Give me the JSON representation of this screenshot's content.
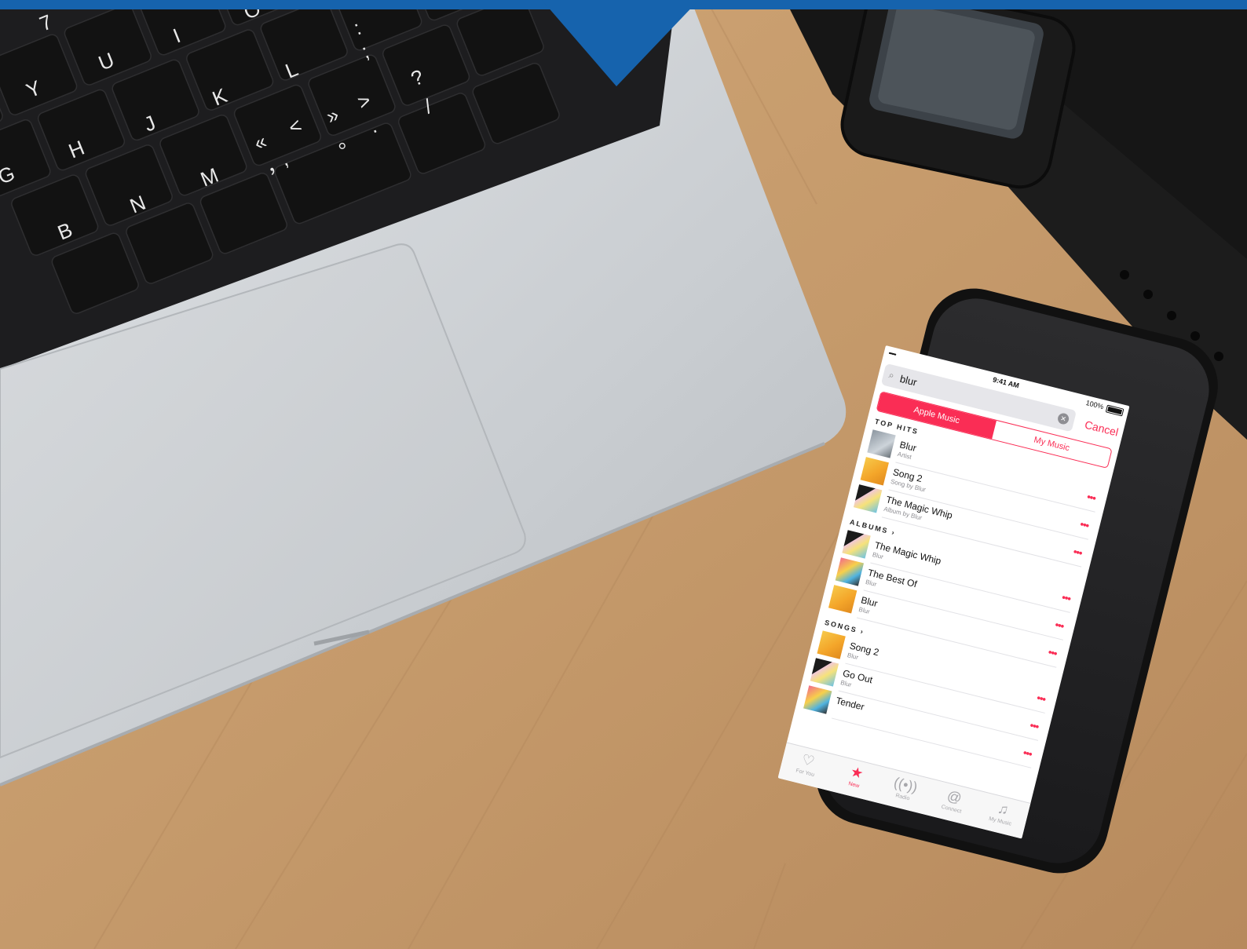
{
  "scene": {
    "colors": {
      "banner_blue": "#1663ad",
      "desk_wood": "#c59a6b",
      "laptop_silver": "#cfd3d7",
      "key_black": "#151515",
      "phone_case": "#121212",
      "watch_black": "#161616",
      "accent": "#fa2d55"
    },
    "keyboard": {
      "keys": [
        "7",
        "O",
        "I",
        "U",
        "Y",
        "L",
        "K",
        "J",
        "H",
        "G",
        "M",
        "N",
        "B",
        "?",
        "/",
        ":",
        ";",
        ">",
        ".",
        "»",
        "。",
        "<",
        ",",
        "«",
        "，"
      ]
    }
  },
  "phone": {
    "status": {
      "signal": "•••••",
      "time": "9:41 AM",
      "battery": "100%"
    },
    "search": {
      "query": "blur",
      "cancel": "Cancel"
    },
    "segments": [
      {
        "label": "Apple Music",
        "active": true
      },
      {
        "label": "My Music",
        "active": false
      }
    ],
    "sections": [
      {
        "title": "TOP HITS",
        "items": [
          {
            "title": "Blur",
            "subtitle": "Artist",
            "art": "artist"
          },
          {
            "title": "Song 2",
            "subtitle": "Song by Blur",
            "art": "yellow"
          },
          {
            "title": "The Magic Whip",
            "subtitle": "Album by Blur",
            "art": "icecream"
          }
        ]
      },
      {
        "title": "ALBUMS ›",
        "items": [
          {
            "title": "The Magic Whip",
            "subtitle": "Blur",
            "art": "icecream"
          },
          {
            "title": "The Best Of",
            "subtitle": "Blur",
            "art": "faces"
          },
          {
            "title": "Blur",
            "subtitle": "Blur",
            "art": "yellow"
          }
        ]
      },
      {
        "title": "SONGS ›",
        "items": [
          {
            "title": "Song 2",
            "subtitle": "Blur",
            "art": "yellow"
          },
          {
            "title": "Go Out",
            "subtitle": "Blur",
            "art": "icecream"
          },
          {
            "title": "Tender",
            "subtitle": "",
            "art": "faces"
          }
        ]
      }
    ],
    "more_glyph": "•••",
    "tabs": [
      {
        "label": "For You",
        "icon": "heart-icon",
        "glyph": "♡",
        "active": false
      },
      {
        "label": "New",
        "icon": "star-icon",
        "glyph": "★",
        "active": true
      },
      {
        "label": "Radio",
        "icon": "radio-icon",
        "glyph": "((•))",
        "active": false
      },
      {
        "label": "Connect",
        "icon": "at-icon",
        "glyph": "@",
        "active": false
      },
      {
        "label": "My Music",
        "icon": "music-note-icon",
        "glyph": "♫",
        "active": false
      }
    ]
  }
}
